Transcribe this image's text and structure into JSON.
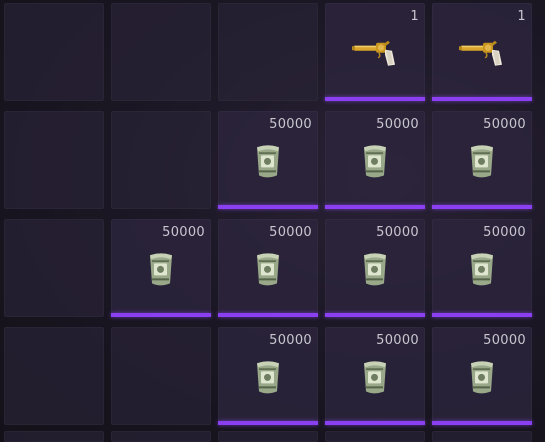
{
  "inventory": {
    "slots": [
      {
        "item": null
      },
      {
        "item": null
      },
      {
        "item": null
      },
      {
        "item": "revolver",
        "count": "1"
      },
      {
        "item": "revolver",
        "count": "1"
      },
      {
        "item": null
      },
      {
        "item": null
      },
      {
        "item": "cash-stack",
        "count": "50000"
      },
      {
        "item": "cash-stack",
        "count": "50000"
      },
      {
        "item": "cash-stack",
        "count": "50000"
      },
      {
        "item": null
      },
      {
        "item": "cash-stack",
        "count": "50000"
      },
      {
        "item": "cash-stack",
        "count": "50000"
      },
      {
        "item": "cash-stack",
        "count": "50000"
      },
      {
        "item": "cash-stack",
        "count": "50000"
      },
      {
        "item": null
      },
      {
        "item": null
      },
      {
        "item": "cash-stack",
        "count": "50000"
      },
      {
        "item": "cash-stack",
        "count": "50000"
      },
      {
        "item": "cash-stack",
        "count": "50000"
      }
    ],
    "accent_color": "#8a3ff0"
  }
}
